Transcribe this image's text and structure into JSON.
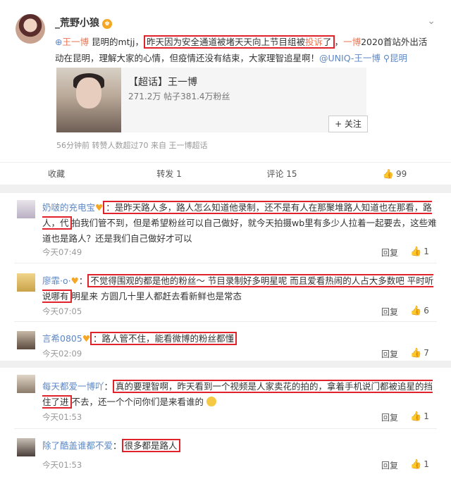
{
  "post": {
    "username": "_荒野小狼",
    "text_a": "王一博",
    "text_b": " 昆明的mtjj，",
    "text_c": "昨天因为安全通道被堵天天向上节目组被",
    "text_d": "投诉",
    "text_e": "了",
    "text_f": "，",
    "text_g": "一博",
    "text_h": "2020首站外出活动在昆明，理解大家的心情，但疫情还没有结束，大家理智追星啊！",
    "text_i": "@UNIQ-王一博",
    "text_j": "昆明",
    "card_title": "【超话】王一博",
    "card_stats": "271.2万  帖子381.4万粉丝",
    "follow_label": "+ 关注",
    "meta": "56分钟前 转赞人数超过70  来自 王一博超话",
    "actions": {
      "collect": "收藏",
      "repost": "转发 1",
      "comment": "评论 15",
      "like": "99"
    }
  },
  "comments": [
    {
      "name": "奶啵的充电宝",
      "box": "：是昨天路人多，路人怎么知道他录制，还不是有人在那聚堆路人知道也在那看，路人，代",
      "rest": "拍我们管不到，但是希望粉丝可以自己做好，就今天拍摄wb里有多少人拉着一起要去，这些难道也是路人？还是我们自己做好才可以",
      "time": "今天07:49",
      "reply": "回复",
      "likes": "1"
    },
    {
      "name": "廖霏·o·",
      "box": "不觉得围观的都是他的粉丝～ 节目录制好多明星呢 而且爱看热闹的人占大多数吧 平时听说哪有",
      "rest": "明星来 方圆几十里人都赶去看新鲜也是常态",
      "time": "今天07:05",
      "reply": "回复",
      "likes": "6"
    },
    {
      "name": "言希0805",
      "box": "：路人管不住，能看微博的粉丝都懂",
      "rest": "",
      "time": "今天02:09",
      "reply": "回复",
      "likes": "7"
    },
    {
      "name": "每天都爱一博吖",
      "box": "真的要理智啊，昨天看到一个视频是人家卖花的拍的，拿着手机说门都被追星的挡住了进",
      "rest": "不去，还一个个问你们是来看谁的",
      "time": "今天01:53",
      "reply": "回复",
      "likes": "1"
    },
    {
      "name": "除了酷盖谁都不爱",
      "box": "很多都是路人",
      "rest": "",
      "time": "今天01:53",
      "reply": "回复",
      "likes": "1"
    }
  ]
}
